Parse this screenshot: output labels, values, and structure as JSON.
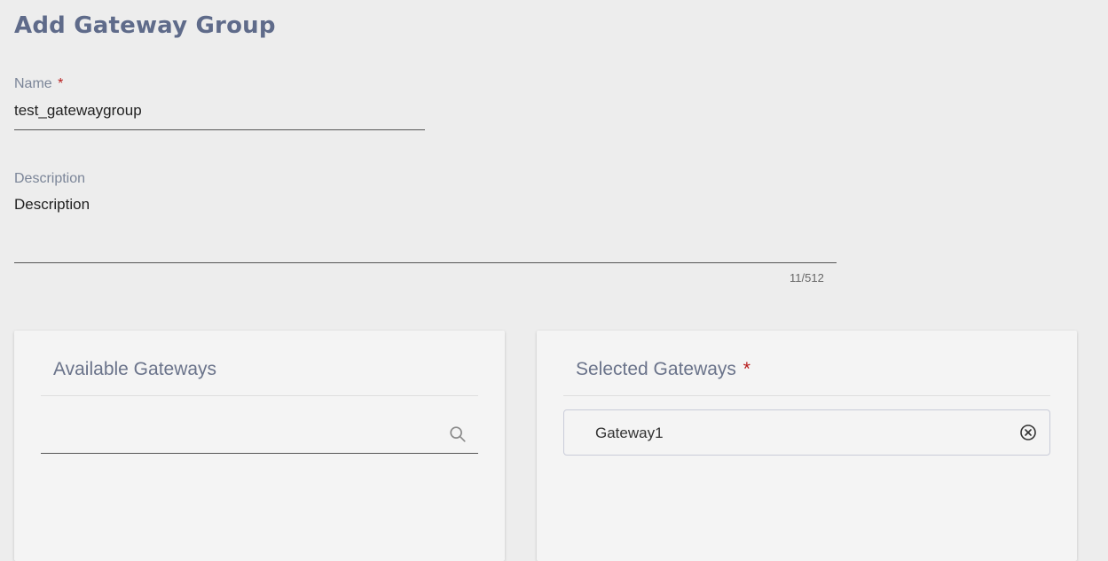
{
  "page": {
    "title": "Add Gateway Group"
  },
  "form": {
    "name": {
      "label": "Name",
      "required_mark": "*",
      "value": "test_gatewaygroup"
    },
    "description": {
      "label": "Description",
      "value": "Description",
      "counter": "11/512"
    }
  },
  "available_gateways": {
    "title": "Available Gateways",
    "search_value": "",
    "search_icon": "search-icon"
  },
  "selected_gateways": {
    "title": "Selected Gateways",
    "required_mark": "*",
    "items": [
      {
        "label": "Gateway1",
        "remove_icon": "close-circle-icon"
      }
    ]
  },
  "colors": {
    "background": "#ededed",
    "title": "#5f6b8a",
    "label": "#7b8598",
    "required": "#b81c1c",
    "card": "#f4f4f4"
  }
}
